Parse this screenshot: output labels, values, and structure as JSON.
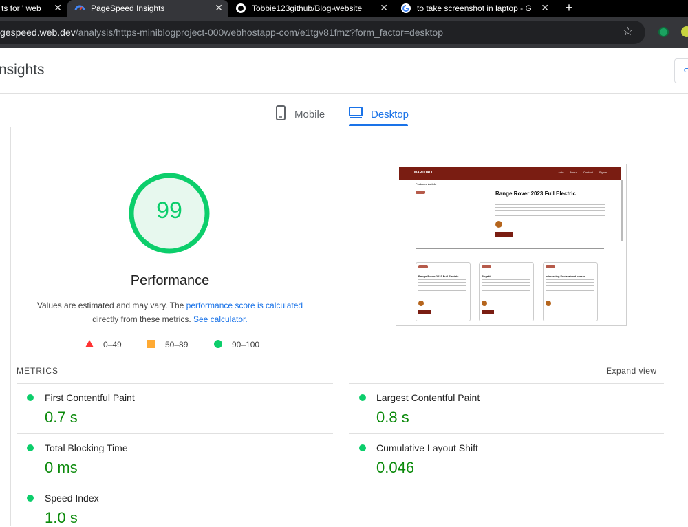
{
  "browser": {
    "tabs": [
      {
        "title": "ts for ' web",
        "favicon": "doc-icon"
      },
      {
        "title": "PageSpeed Insights",
        "favicon": "pagespeed-icon"
      },
      {
        "title": "Tobbie123github/Blog-website",
        "favicon": "github-icon"
      },
      {
        "title": "to take screenshot in laptop - G",
        "favicon": "google-icon"
      }
    ],
    "close_glyph": "✕",
    "new_tab_glyph": "+",
    "url_host": "gespeed.web.dev",
    "url_path": "/analysis/https-miniblogproject-000webhostapp-com/e1tgv81fmz?form_factor=desktop"
  },
  "header": {
    "title": "nsights"
  },
  "device_tabs": [
    {
      "label": "Mobile",
      "icon": "mobile-icon"
    },
    {
      "label": "Desktop",
      "icon": "desktop-icon",
      "selected": true
    }
  ],
  "performance": {
    "score": "99",
    "score_fraction": 0.99,
    "title": "Performance",
    "desc_prefix": "Values are estimated and may vary. The ",
    "desc_link1": "performance score is calculated",
    "desc_middle": " directly from these metrics. ",
    "desc_link2": "See calculator.",
    "legend": [
      {
        "range": "0–49",
        "shape": "triangle",
        "color": "#ff3333"
      },
      {
        "range": "50–89",
        "shape": "square",
        "color": "#ffaa33"
      },
      {
        "range": "90–100",
        "shape": "circle",
        "color": "#0cce6b"
      }
    ]
  },
  "preview": {
    "brand": "MARTDALL",
    "nav_links": "Auto About Contact Signin",
    "featured": "Featured Article",
    "headline": "Range Rover 2023 Full Electric",
    "cards": [
      "Range Rover 2023 Full Electric",
      "Bugatti",
      "Interesting Facts about horses."
    ]
  },
  "metrics": {
    "label": "METRICS",
    "expand": "Expand view",
    "items": [
      {
        "name": "First Contentful Paint",
        "value": "0.7 s"
      },
      {
        "name": "Largest Contentful Paint",
        "value": "0.8 s"
      },
      {
        "name": "Total Blocking Time",
        "value": "0 ms"
      },
      {
        "name": "Cumulative Layout Shift",
        "value": "0.046"
      },
      {
        "name": "Speed Index",
        "value": "1.0 s"
      }
    ]
  },
  "colors": {
    "good": "#0cce6b",
    "accent": "#1a73e8",
    "metric_value": "#0b8a0b"
  }
}
